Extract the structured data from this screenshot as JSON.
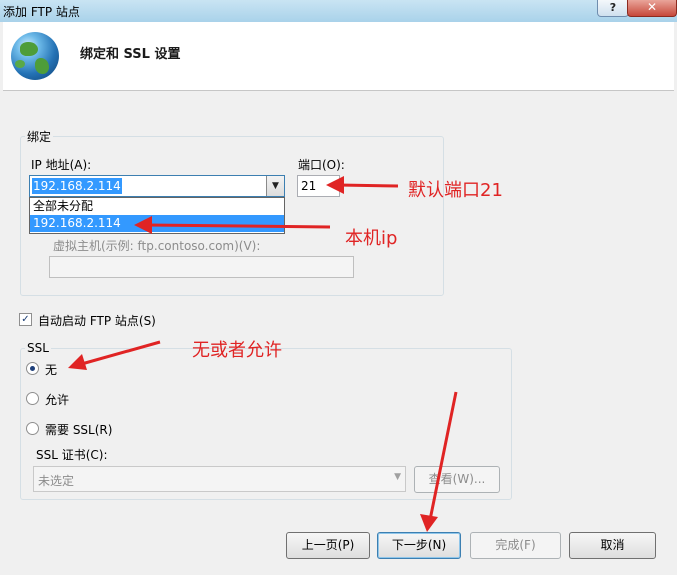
{
  "window": {
    "title": "添加 FTP 站点",
    "help_glyph": "?",
    "close_glyph": "✕"
  },
  "header": {
    "title": "绑定和 SSL 设置",
    "icon": "globe-icon"
  },
  "binding": {
    "legend": "绑定",
    "ip_label": "IP 地址(A):",
    "ip_value": "192.168.2.114",
    "dropdown_options": [
      "全部未分配",
      "192.168.2.114"
    ],
    "dropdown_selected_index": 1,
    "port_label": "端口(O):",
    "port_value": "21",
    "vhost_label": "虚拟主机(示例: ftp.contoso.com)(V):",
    "vhost_value": ""
  },
  "autostart": {
    "label": "自动启动 FTP 站点(S)",
    "checked": true
  },
  "ssl": {
    "legend": "SSL",
    "options": [
      "无",
      "允许",
      "需要 SSL(R)"
    ],
    "selected_index": 0,
    "cert_label": "SSL 证书(C):",
    "cert_value": "未选定",
    "view_button": "查看(W)..."
  },
  "buttons": {
    "prev": "上一页(P)",
    "next": "下一步(N)",
    "finish": "完成(F)",
    "cancel": "取消"
  },
  "annotations": {
    "port_note": "默认端口21",
    "ip_note": "本机ip",
    "ssl_note": "无或者允许",
    "color": "#e02424"
  }
}
